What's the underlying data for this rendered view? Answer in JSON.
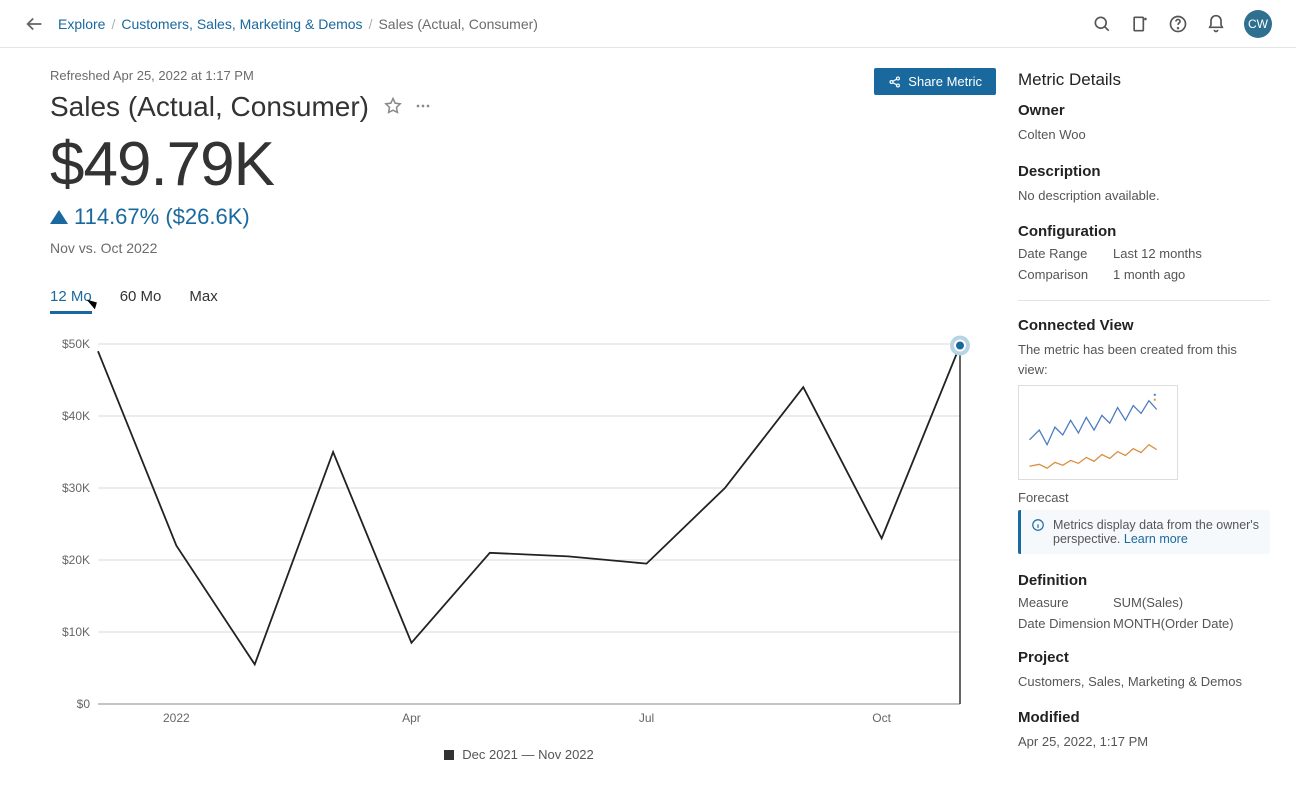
{
  "breadcrumb": {
    "root": "Explore",
    "parent": "Customers, Sales, Marketing & Demos",
    "current": "Sales (Actual, Consumer)"
  },
  "avatar_initials": "CW",
  "refreshed": "Refreshed Apr 25, 2022 at 1:17 PM",
  "share_label": "Share Metric",
  "title": "Sales (Actual, Consumer)",
  "big_value": "$49.79K",
  "delta": "114.67% ($26.6K)",
  "compare_label": "Nov vs. Oct 2022",
  "range_tabs": {
    "t12": "12 Mo",
    "t60": "60 Mo",
    "tmax": "Max"
  },
  "legend": "Dec 2021 — Nov 2022",
  "sidebar": {
    "header": "Metric Details",
    "owner_h": "Owner",
    "owner": "Colten Woo",
    "desc_h": "Description",
    "desc": "No description available.",
    "config_h": "Configuration",
    "config_dr_k": "Date Range",
    "config_dr_v": "Last 12 months",
    "config_cmp_k": "Comparison",
    "config_cmp_v": "1 month ago",
    "cv_h": "Connected View",
    "cv_text": "The metric has been created from this view:",
    "cv_link": "Forecast",
    "callout_text": "Metrics display data from the owner's perspective. ",
    "callout_link": "Learn more",
    "def_h": "Definition",
    "def_measure_k": "Measure",
    "def_measure_v": "SUM(Sales)",
    "def_dim_k": "Date Dimension",
    "def_dim_v": "MONTH(Order Date)",
    "proj_h": "Project",
    "proj_link": "Customers, Sales, Marketing & Demos",
    "mod_h": "Modified",
    "mod_v": "Apr 25, 2022, 1:17 PM"
  },
  "chart_data": {
    "type": "line",
    "title": "",
    "xlabel": "",
    "ylabel": "",
    "ylim": [
      0,
      50000
    ],
    "y_ticks": [
      "$0",
      "$10K",
      "$20K",
      "$30K",
      "$40K",
      "$50K"
    ],
    "x_ticks": [
      "2022",
      "Apr",
      "Jul",
      "Oct"
    ],
    "categories": [
      "Dec 2021",
      "Jan 2022",
      "Feb 2022",
      "Mar 2022",
      "Apr 2022",
      "May 2022",
      "Jun 2022",
      "Jul 2022",
      "Aug 2022",
      "Sep 2022",
      "Oct 2022",
      "Nov 2022"
    ],
    "values": [
      49000,
      22000,
      5500,
      35000,
      8500,
      21000,
      20500,
      19500,
      30000,
      44000,
      23000,
      49790
    ]
  }
}
